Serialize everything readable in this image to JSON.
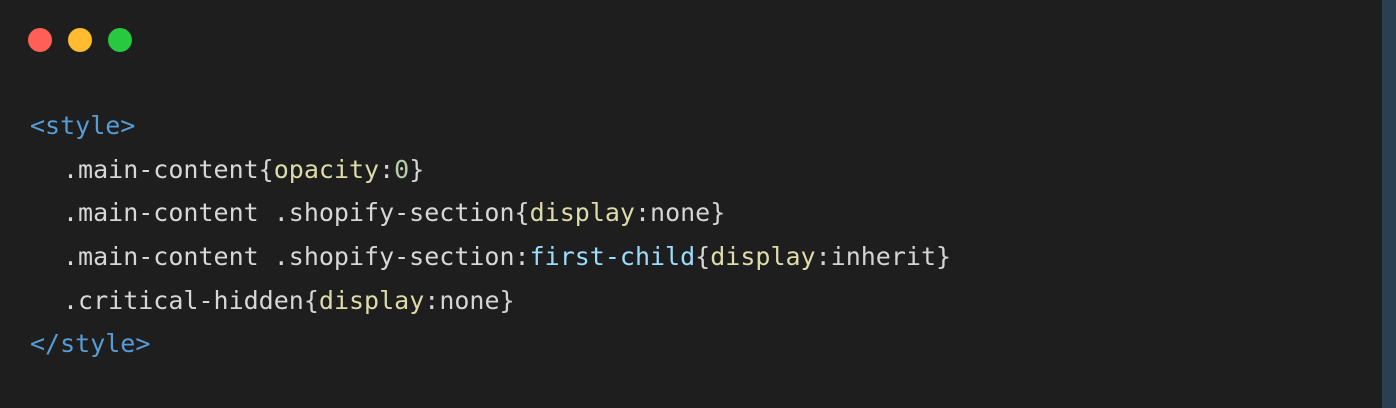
{
  "window": {
    "controls": [
      {
        "name": "close",
        "color": "#ff5f57"
      },
      {
        "name": "minimize",
        "color": "#febc2e"
      },
      {
        "name": "zoom",
        "color": "#28c840"
      }
    ]
  },
  "code": {
    "open_tag": "<style>",
    "close_tag": "</style>",
    "rules": [
      {
        "selector": ".main-content",
        "pseudo": "",
        "open_brace": "{",
        "property": "opacity",
        "colon": ":",
        "value": "0",
        "value_type": "number",
        "close_brace": "}"
      },
      {
        "selector": ".main-content .shopify-section",
        "pseudo": "",
        "open_brace": "{",
        "property": "display",
        "colon": ":",
        "value": "none",
        "value_type": "keyword",
        "close_brace": "}"
      },
      {
        "selector": ".main-content .shopify-section:",
        "pseudo": "first-child",
        "open_brace": "{",
        "property": "display",
        "colon": ":",
        "value": "inherit",
        "value_type": "keyword",
        "close_brace": "}"
      },
      {
        "selector": ".critical-hidden",
        "pseudo": "",
        "open_brace": "{",
        "property": "display",
        "colon": ":",
        "value": "none",
        "value_type": "keyword",
        "close_brace": "}"
      }
    ]
  }
}
